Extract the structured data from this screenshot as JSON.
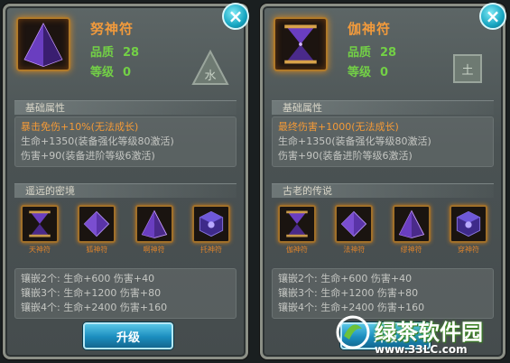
{
  "left_panel": {
    "name": "努神符",
    "quality_label": "品质",
    "quality_value": "28",
    "level_label": "等级",
    "level_value": "0",
    "element": "水",
    "base_title": "基础属性",
    "base_lines": [
      "暴击免伤+10%(无法成长)",
      "生命+1350(装备强化等级80激活)",
      "伤害+90(装备进阶等级6激活)"
    ],
    "set_title": "遥远的密境",
    "set_runes": [
      "天神符",
      "狐神符",
      "啊神符",
      "托神符"
    ],
    "inlay_lines": [
      "镶嵌2个: 生命+600 伤害+40",
      "镶嵌3个: 生命+1200 伤害+80",
      "镶嵌4个: 生命+2400 伤害+160"
    ],
    "button": "升级"
  },
  "right_panel": {
    "name": "伽神符",
    "quality_label": "品质",
    "quality_value": "28",
    "level_label": "等级",
    "level_value": "0",
    "element": "土",
    "base_title": "基础属性",
    "base_lines": [
      "最终伤害+1000(无法成长)",
      "生命+1350(装备强化等级80激活)",
      "伤害+90(装备进阶等级6激活)"
    ],
    "set_title": "古老的传说",
    "set_runes": [
      "伽神符",
      "法神符",
      "缪神符",
      "穿神符"
    ],
    "inlay_lines": [
      "镶嵌2个: 生命+600 伤害+40",
      "镶嵌3个: 生命+1200 伤害+80",
      "镶嵌4个: 生命+2400 伤害+160"
    ],
    "button": "升级"
  },
  "close_icon": "×",
  "watermark": {
    "text": "绿茶软件园",
    "url": "www.33LC.com"
  },
  "colors": {
    "name": "#f19a3c",
    "stat": "#73d046",
    "highlight": "#f39a37",
    "button": "#1b8dbe"
  }
}
